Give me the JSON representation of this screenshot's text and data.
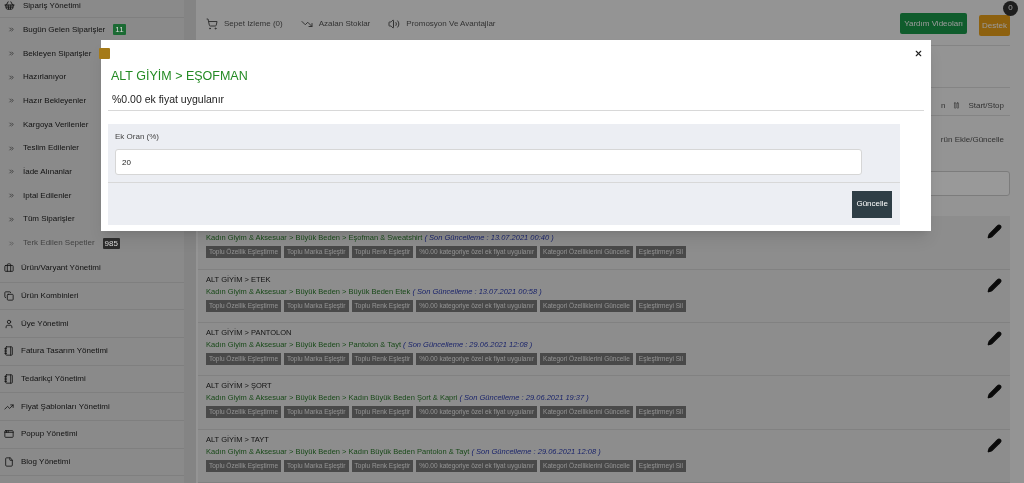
{
  "sidebar": {
    "group": {
      "title": "Sipariş Yönetimi",
      "items": [
        {
          "label": "Bugün Gelen Siparişler",
          "disabled": false,
          "badge": {
            "text": "11",
            "color": "#1b6a33"
          }
        },
        {
          "label": "Bekleyen Siparişler",
          "disabled": false,
          "badge": {
            "color": "#a57a18"
          }
        },
        {
          "label": "Hazırlanıyor",
          "disabled": false
        },
        {
          "label": "Hazır Bekleyenler",
          "disabled": false
        },
        {
          "label": "Kargoya Verilenler",
          "disabled": false
        },
        {
          "label": "Teslim Edilenler",
          "disabled": false
        },
        {
          "label": "İade Alınanlar",
          "disabled": false
        },
        {
          "label": "Iptal Edilenler",
          "disabled": false
        },
        {
          "label": "Tüm Siparişler",
          "disabled": false
        },
        {
          "label": "Terk Edilen Sepetler",
          "disabled": true,
          "badge": {
            "text": "985",
            "color": "#2b2b2b"
          }
        }
      ]
    },
    "sections": [
      "Ürün/Varyant Yönetimi",
      "Ürün Kombinleri",
      "Üye Yönetimi",
      "Fatura Tasarım Yönetimi",
      "Tedarikçi Yönetimi",
      "Fiyat Şablonları Yönetimi",
      "Popup Yönetimi",
      "Blog Yönetimi"
    ]
  },
  "topbar": {
    "links": [
      "Sepet Izleme (0)",
      "Azalan Stoklar",
      "Promosyon Ve Avantajlar"
    ],
    "help_button": "Yardım Videoları",
    "support_button": "Destek",
    "support_badge": "0"
  },
  "toolbar": {
    "cut_text": "n",
    "start_stop": "Start/Stop",
    "cut_link": "rün Ekle/Güncelle"
  },
  "rows": [
    {
      "path": "Kadın Giyim & Aksesuar > Büyük Beden > Eşofman & Sweatshirt",
      "updated": "( Son Güncelleme : 13.07.2021 00:40 )",
      "actions": [
        "Toplu Özellik Eşleştirme",
        "Toplu Marka Eşleştir",
        "Toplu Renk Eşleştir",
        "%0.00 kategoriye özel ek fiyat uygulanır",
        "Kategori Özelliklerini Güncelle",
        "Eşleştirmeyi Sil"
      ]
    },
    {
      "title": "ALT GİYİM > ETEK",
      "path": "Kadın Giyim & Aksesuar > Büyük Beden > Büyük Beden Etek",
      "updated": "( Son Güncelleme : 13.07.2021 00:58 )",
      "actions": [
        "Toplu Özellik Eşleştirme",
        "Toplu Marka Eşleştir",
        "Toplu Renk Eşleştir",
        "%0.00 kategoriye özel ek fiyat uygulanır",
        "Kategori Özelliklerini Güncelle",
        "Eşleştirmeyi Sil"
      ]
    },
    {
      "title": "ALT GİYİM > PANTOLON",
      "path": "Kadın Giyim & Aksesuar > Büyük Beden > Pantolon & Tayt",
      "updated": "( Son Güncelleme : 29.06.2021 12:08 )",
      "actions": [
        "Toplu Özellik Eşleştirme",
        "Toplu Marka Eşleştir",
        "Toplu Renk Eşleştir",
        "%0.00 kategoriye özel ek fiyat uygulanır",
        "Kategori Özelliklerini Güncelle",
        "Eşleştirmeyi Sil"
      ]
    },
    {
      "title": "ALT GİYİM > ŞORT",
      "path": "Kadın Giyim & Aksesuar > Büyük Beden > Kadın Büyük Beden Şort & Kapri",
      "updated": "( Son Güncelleme : 29.06.2021 19:37 )",
      "actions": [
        "Toplu Özellik Eşleştirme",
        "Toplu Marka Eşleştir",
        "Toplu Renk Eşleştir",
        "%0.00 kategoriye özel ek fiyat uygulanır",
        "Kategori Özelliklerini Güncelle",
        "Eşleştirmeyi Sil"
      ]
    },
    {
      "title": "ALT GİYİM > TAYT",
      "path": "Kadın Giyim & Aksesuar > Büyük Beden > Kadın Büyük Beden Pantolon & Tayt",
      "updated": "( Son Güncelleme : 29.06.2021 12:08 )",
      "actions": [
        "Toplu Özellik Eşleştirme",
        "Toplu Marka Eşleştir",
        "Toplu Renk Eşleştir",
        "%0.00 kategoriye özel ek fiyat uygulanır",
        "Kategori Özelliklerini Güncelle",
        "Eşleştirmeyi Sil"
      ]
    }
  ],
  "modal": {
    "title": "ALT GİYİM > EŞOFMAN",
    "subtitle": "%0.00 ek fiyat uygulanır",
    "field_label": "Ek Oran (%)",
    "field_value": "20",
    "submit": "Güncelle"
  }
}
